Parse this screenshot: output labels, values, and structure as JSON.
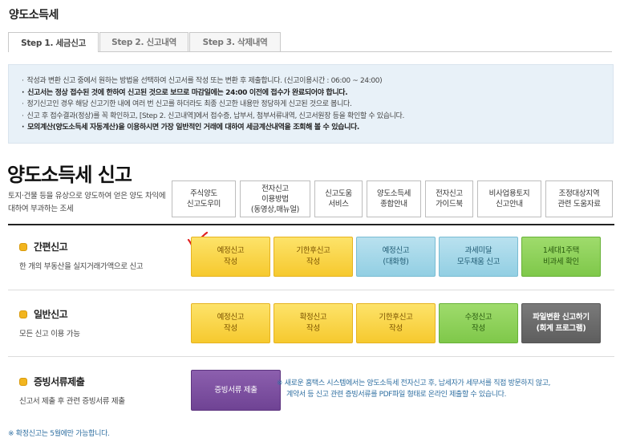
{
  "page": {
    "title": "양도소득세"
  },
  "tabs": [
    {
      "label": "Step 1. 세금신고",
      "active": true
    },
    {
      "label": "Step 2. 신고내역",
      "active": false
    },
    {
      "label": "Step 3. 삭제내역",
      "active": false
    }
  ],
  "notice": {
    "lines": [
      "작성과 변환 신고 중에서 원하는 방법을 선택하여 신고서를 작성 또는 변환 후 제출합니다. (신고이용시간 : 06:00 ~ 24:00)",
      "신고서는 정상 접수된 것에 한하여 신고된 것으로 보므로 마감일에는 24:00 이전에 접수가 완료되어야 합니다.",
      "정기신고인 경우 해당 신고기한 내에 여러 번 신고를 하더라도 최종 신고한 내용만 정당하게 신고된 것으로 봅니다.",
      "신고 후 접수결과(정상)를 꼭 확인하고, [Step 2. 신고내역]에서 접수증, 납부서, 첨부서류내역, 신고서원장 등을 확인할 수 있습니다.",
      "모의계산(양도소득세 자동계산)을 이용하시면 가장 일반적인 거래에 대하여 세금계산내역을 조회해 볼 수 있습니다."
    ]
  },
  "section": {
    "title": "양도소득세 신고",
    "desc": "토지·건물 등을 유상으로 양도하여 얻은 양도 차익에 대하여 부과하는 조세"
  },
  "quick_buttons": [
    "주식양도\n신고도우미",
    "전자신고\n이용방법\n(동영상,매뉴얼)",
    "신고도움\n서비스",
    "양도소득세\n종합안내",
    "전자신고\n가이드북",
    "비사업용토지\n신고안내",
    "조정대상지역\n관련 도움자료"
  ],
  "simple": {
    "title": "간편신고",
    "desc": "한 개의 부동산을 실지거래가액으로 신고",
    "buttons": [
      "예정신고\n작성",
      "기한후신고\n작성",
      "예정신고\n(대화형)",
      "과세미달\n모두채움 신고",
      "1세대1주택\n비과세 확인"
    ]
  },
  "general": {
    "title": "일반신고",
    "desc": "모든 신고 이용 가능",
    "buttons": [
      "예정신고\n작성",
      "확정신고\n작성",
      "기한후신고\n작성",
      "수정신고\n작성",
      "파일변환 신고하기\n(회계 프로그램)"
    ]
  },
  "proof": {
    "title": "증빙서류제출",
    "desc": "신고서 제출 후 관련 증빙서류 제출",
    "button": "증빙서류 제출",
    "note_line1": "※ 새로운 홈택스 시스템에서는 양도소득세 전자신고 후, 납세자가 세무서를 직접 방문하지 않고,",
    "note_line2": "계약서 등 신고 관련 증빙서류를 PDF파일 형태로 온라인 제출할 수 있습니다."
  },
  "footnote": "※ 확정신고는 5월에만 가능합니다.",
  "colors": {
    "accent_check": "#e02020",
    "bullet": "#f2b51f",
    "link_blue": "#2f6fa1"
  }
}
